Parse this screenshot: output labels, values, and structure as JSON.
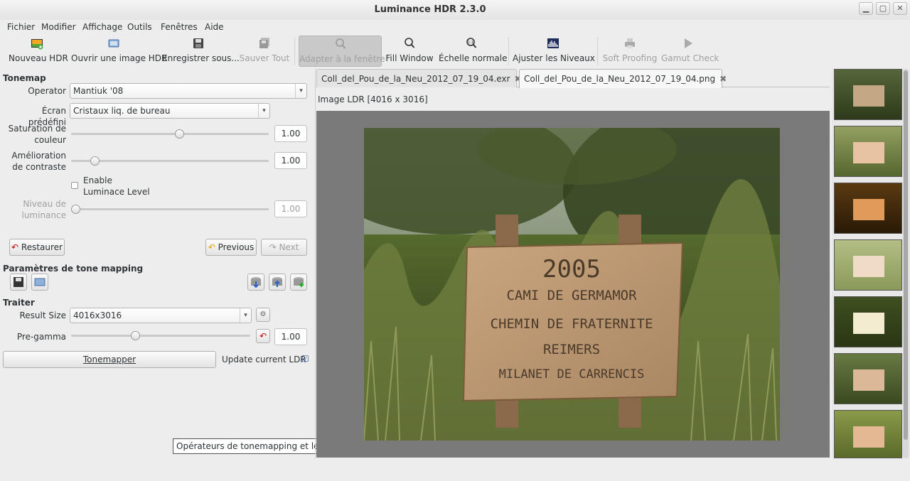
{
  "window": {
    "title": "Luminance HDR 2.3.0",
    "controls": [
      "▁",
      "▢",
      "✕"
    ]
  },
  "menu": [
    "Fichier",
    "Modifier",
    "Affichage",
    "Outils",
    "Fenêtres",
    "Aide"
  ],
  "toolbar": {
    "new_hdr": "Nouveau HDR",
    "open_hdr": "Ouvrir une image HDR",
    "save_as": "Enregistrer sous...",
    "save_all": "Sauver Tout",
    "fit_window": "Adapter à la fenêtre",
    "fill_window": "Fill Window",
    "normal_scale": "Échelle normale",
    "adjust_levels": "Ajuster les Niveaux",
    "soft_proofing": "Soft Proofing",
    "gamut_check": "Gamut Check"
  },
  "tonemap": {
    "header": "Tonemap",
    "operator_label": "Operator",
    "operator_value": "Mantiuk '08",
    "preset_label": "Écran prédéfini",
    "preset_value": "Cristaux liq. de bureau",
    "saturation_label1": "Saturation de",
    "saturation_label2": "couleur",
    "saturation_value": "1.00",
    "saturation_level": 0.55,
    "contrast_label1": "Amélioration",
    "contrast_label2": "de contraste",
    "contrast_value": "1.00",
    "contrast_level": 0.1,
    "enable_label1": "Enable",
    "enable_label2": "Luminace Level",
    "luminance_label1": "Niveau de",
    "luminance_label2": "luminance",
    "luminance_value": "1.00",
    "luminance_level": 0.0,
    "restore": "Restaurer",
    "previous": "Previous",
    "next": "Next"
  },
  "params": {
    "header": "Paramètres de tone mapping"
  },
  "process": {
    "header": "Traiter",
    "result_size_label": "Result Size",
    "result_size_value": "4016x3016",
    "pregamma_label": "Pre-gamma",
    "pregamma_value": "1.00",
    "pregamma_level": 0.35,
    "tonemap_button": "Tonemapper",
    "update_label": "Update current LDR"
  },
  "tooltip": "Opérateurs de tonemapping et leurs options",
  "tabs": [
    {
      "label": "Coll_del_Pou_de_la_Neu_2012_07_19_04.exr"
    },
    {
      "label": "Coll_del_Pou_de_la_Neu_2012_07_19_04.png"
    }
  ],
  "image_info": "Image LDR [4016 x 3016]",
  "sign": {
    "line1": "2005",
    "line2": "CAMI DE GERMAMOR",
    "line3": "CHEMIN DE FRATERNITE",
    "line4": "REIMERS",
    "line5": "MILANET DE CARRENCIS"
  },
  "colors": {
    "accent": "#3465a4",
    "viewer_bg": "#7a7a7a"
  }
}
